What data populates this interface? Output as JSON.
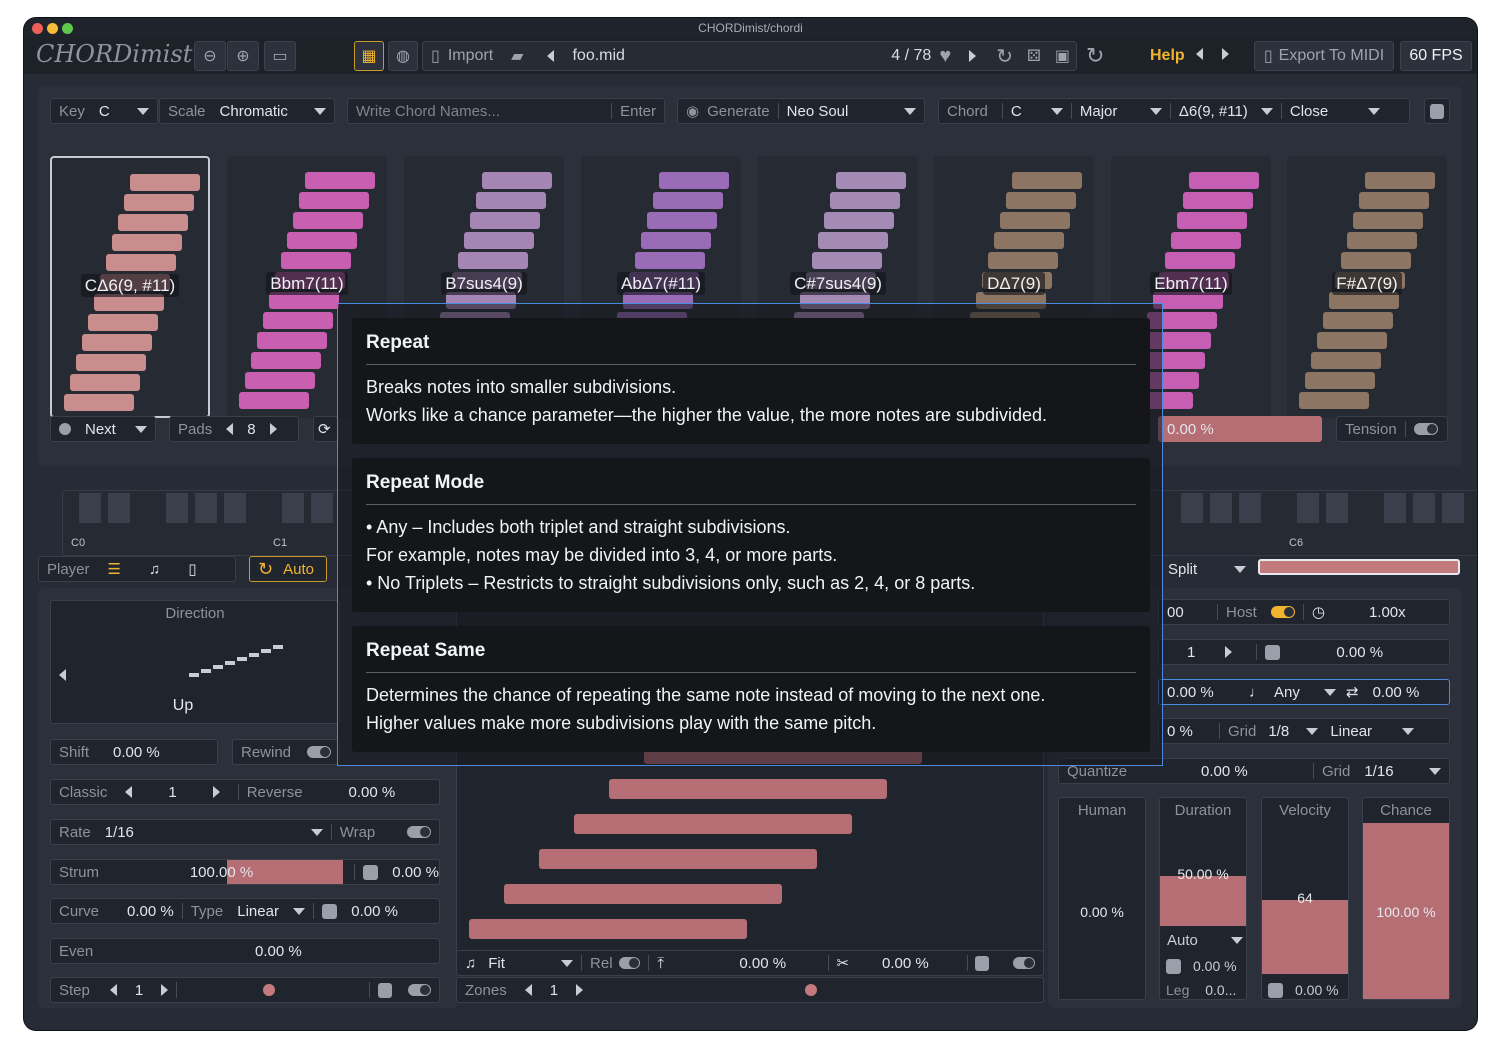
{
  "window": {
    "title": "CHORDimist/chordi"
  },
  "toolbar": {
    "logo": "CHORDimist",
    "import_label": "Import",
    "file_name": "foo.mid",
    "file_index": "4 / 78",
    "help_label": "Help",
    "export_label": "Export To MIDI",
    "fps": "60 FPS"
  },
  "controls": {
    "key_label": "Key",
    "key_value": "C",
    "scale_label": "Scale",
    "scale_value": "Chromatic",
    "chord_names_placeholder": "Write Chord Names...",
    "enter_label": "Enter",
    "generate_label": "Generate",
    "generate_value": "Neo Soul",
    "chord_label": "Chord",
    "chord_root": "C",
    "chord_quality": "Major",
    "chord_extension": "Δ6(9, #11)",
    "chord_voicing": "Close"
  },
  "pads": [
    {
      "name": "CΔ6(9, #11)",
      "color": "#c98d8d"
    },
    {
      "name": "Bbm7(11)",
      "color": "#c95fb0"
    },
    {
      "name": "B7sus4(9)",
      "color": "#a585b4"
    },
    {
      "name": "AbΔ7(#11)",
      "color": "#9a6cb8"
    },
    {
      "name": "C#7sus4(9)",
      "color": "#a48bb5"
    },
    {
      "name": "DΔ7(9)",
      "color": "#8c7663"
    },
    {
      "name": "Ebm7(11)",
      "color": "#c65fb4"
    },
    {
      "name": "F#Δ7(9)",
      "color": "#8c7663"
    }
  ],
  "pad_controls": {
    "next_label": "Next",
    "pads_label": "Pads",
    "pads_value": "8",
    "strum_percent": "0.00 %",
    "tension_label": "Tension"
  },
  "piano": {
    "c0": "C0",
    "c1": "C1",
    "c6": "C6"
  },
  "player": {
    "player_label": "Player",
    "auto_label": "Auto",
    "direction_title": "Direction",
    "direction_value": "Up",
    "shift_label": "Shift",
    "shift_value": "0.00 %",
    "rewind_label": "Rewind",
    "classic_label": "Classic",
    "classic_value": "1",
    "reverse_label": "Reverse",
    "reverse_value": "0.00 %",
    "rate_label": "Rate",
    "rate_value": "1/16",
    "wrap_label": "Wrap",
    "strum_label": "Strum",
    "strum_value": "100.00 %",
    "strum_rand": "0.00 %",
    "curve_label": "Curve",
    "curve_value": "0.00 %",
    "type_label": "Type",
    "type_value": "Linear",
    "type_rand": "0.00 %",
    "even_label": "Even",
    "even_value": "0.00 %",
    "step_label": "Step",
    "step_value": "1"
  },
  "roll": {
    "fit_label": "Fit",
    "rel_label": "Rel",
    "pitch_value": "0.00 %",
    "cut_value": "0.00 %",
    "zones_label": "Zones",
    "zones_value": "1"
  },
  "right": {
    "split_label": "Split",
    "host_prefix": "00",
    "host_label": "Host",
    "speed_value": "1.00x",
    "repeat_count": "1",
    "repeat_value": "0.00 %",
    "repeat_mode_pct": "0.00 %",
    "repeat_mode_value": "Any",
    "repeat_same_value": "0.00 %",
    "grid_prefix": "0 %",
    "grid_label": "Grid",
    "grid_value": "1/8",
    "grid_curve": "Linear",
    "quantize_label": "Quantize",
    "quantize_value": "0.00 %",
    "grid2_label": "Grid",
    "grid2_value": "1/16",
    "human_label": "Human",
    "human_value": "0.00 %",
    "duration_label": "Duration",
    "duration_value": "50.00 %",
    "duration_mode": "Auto",
    "duration_rand": "0.00 %",
    "leg_label": "Leg",
    "leg_value": "0.0...",
    "velocity_label": "Velocity",
    "velocity_value": "64",
    "velocity_rand": "0.00 %",
    "chance_label": "Chance",
    "chance_value": "100.00 %"
  },
  "tooltip": {
    "sections": [
      {
        "title": "Repeat",
        "lines": [
          "Breaks notes into smaller subdivisions.",
          "Works like a chance parameter—the higher the value, the more notes are subdivided."
        ]
      },
      {
        "title": "Repeat Mode",
        "lines": [
          "• Any – Includes both triplet and straight subdivisions.",
          "For example, notes may be divided into 3, 4, or more parts.",
          "• No Triplets – Restricts to straight subdivisions only, such as 2, 4, or 8 parts."
        ]
      },
      {
        "title": "Repeat Same",
        "lines": [
          "Determines the chance of repeating the same note instead of moving to the next one.",
          "Higher values make more subdivisions play with the same pitch."
        ]
      }
    ]
  },
  "colors": {
    "accent": "#f0b430",
    "note": "#b56e73",
    "highlight": "#4a8be0"
  }
}
